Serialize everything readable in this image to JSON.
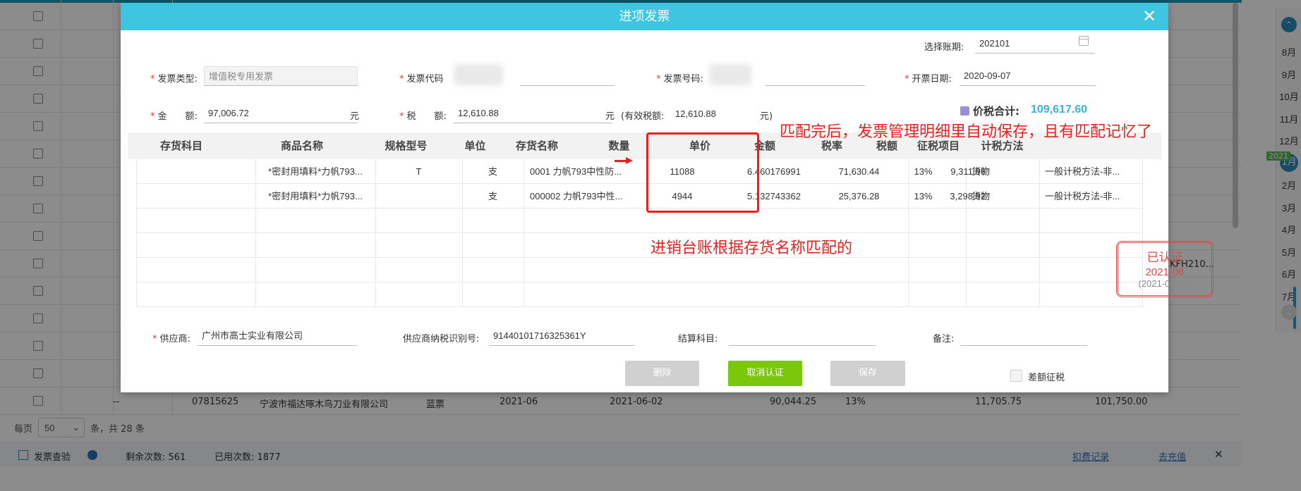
{
  "background": {
    "last_row": {
      "code": "07815625",
      "supplier": "宁波市福达啄木鸟刀业有限公司",
      "type": "蓝票",
      "period": "2021-06",
      "date": "2021-06-02",
      "amount": "90,044.25",
      "rate": "13%",
      "tax": "11,705.75",
      "total": "101,750.00",
      "dash": "--"
    },
    "partial_text": "KFH210...",
    "pager": {
      "per_page_label": "每页",
      "per_page_value": "50",
      "summary": "条，共 28 条"
    },
    "footer": {
      "check_label": "发票查验",
      "remaining_label": "剩余次数: 561",
      "used_label": "已用次数: 1877",
      "deduct_link": "扣费记录",
      "recharge_link": "去充值",
      "close": "✕"
    },
    "side_months": [
      "8月",
      "9月",
      "10月",
      "11月",
      "12月",
      "1月",
      "2月",
      "3月",
      "4月",
      "5月",
      "6月",
      "7月"
    ],
    "side_year": "2021"
  },
  "modal": {
    "title": "进项发票",
    "close": "✕",
    "period": {
      "label": "选择账期:",
      "value": "202101"
    },
    "invoice_type": {
      "label": "发票类型:",
      "value": "增值税专用发票"
    },
    "invoice_code": {
      "label": "发票代码"
    },
    "invoice_number": {
      "label": "发票号码:"
    },
    "invoice_date": {
      "label": "开票日期:",
      "value": "2020-09-07"
    },
    "amount": {
      "label": "金　　额:",
      "value": "97,006.72",
      "unit": "元"
    },
    "tax": {
      "label": "税　　额:",
      "value": "12,610.88",
      "unit": "元",
      "effective_label": "(有效税额:",
      "effective_value": "12,610.88",
      "effective_unit": "元)"
    },
    "total": {
      "label": "价税合计:",
      "value": "109,617.60"
    },
    "table": {
      "headers": [
        "存货科目",
        "商品名称",
        "规格型号",
        "单位",
        "存货名称",
        "数量",
        "单价",
        "金额",
        "税率",
        "税额",
        "征税项目",
        "计税方法"
      ],
      "rows": [
        [
          "",
          "*密封用填料*力帆793...",
          "T",
          "支",
          "0001 力帆793中性防...",
          "11088",
          "6.460176991",
          "71,630.44",
          "13%",
          "9,311.96",
          "货物",
          "一般计税方法-非..."
        ],
        [
          "",
          "*密封用填料*力帆793...",
          "",
          "支",
          "000002 力帆793中性...",
          "4944",
          "5.132743362",
          "25,376.28",
          "13%",
          "3,298.92",
          "货物",
          "一般计税方法-非..."
        ]
      ]
    },
    "annotations": {
      "top": "匹配完后，发票管理明细里自动保存，且有匹配记忆了",
      "middle": "进销台账根据存货名称匹配的"
    },
    "stamp": {
      "status": "已认证",
      "period": "2021-06",
      "date": "(2021-07-02)"
    },
    "supplier": {
      "label": "供应商:",
      "value": "广州市高士实业有限公司"
    },
    "supplier_tax_id": {
      "label": "供应商纳税识别号:",
      "value": "91440101716325361Y"
    },
    "settle_account": {
      "label": "结算科目:",
      "value": ""
    },
    "remark": {
      "label": "备注:",
      "value": ""
    },
    "buttons": {
      "delete": "删除",
      "cancel_cert": "取消认证",
      "save": "保存"
    },
    "diff_tax_label": "差额征税",
    "colors": {
      "header": "#3ec5e0",
      "accent_green": "#7ac70c",
      "annotation_red": "#e82020",
      "total_blue": "#3ab4d8"
    }
  }
}
